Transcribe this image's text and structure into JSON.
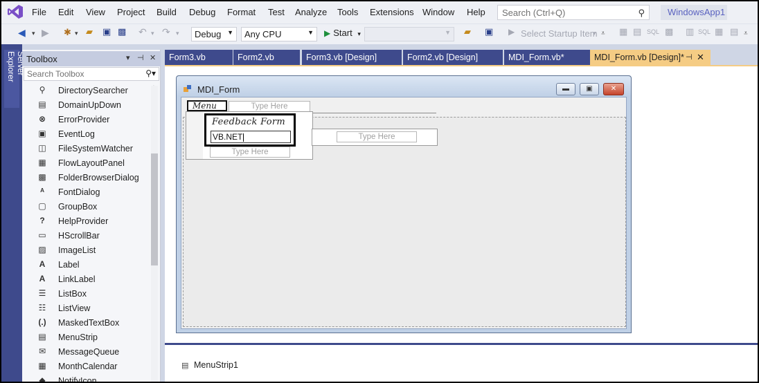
{
  "menubar": {
    "items": [
      "File",
      "Edit",
      "View",
      "Project",
      "Build",
      "Debug",
      "Format",
      "Test",
      "Analyze",
      "Tools",
      "Extensions",
      "Window",
      "Help"
    ],
    "search_placeholder": "Search (Ctrl+Q)",
    "solution_name": "WindowsApp1"
  },
  "toolbar": {
    "configuration": "Debug",
    "platform": "Any CPU",
    "start_label": "Start",
    "startup_item_label": "Select Startup Item"
  },
  "server_explorer": {
    "label": "Server Explorer"
  },
  "toolbox": {
    "title": "Toolbox",
    "search_placeholder": "Search Toolbox",
    "items": [
      {
        "label": "DirectorySearcher",
        "icon": "magnifier-icon",
        "glyph": "⚲"
      },
      {
        "label": "DomainUpDown",
        "icon": "updown-icon",
        "glyph": "▤"
      },
      {
        "label": "ErrorProvider",
        "icon": "error-icon",
        "glyph": "⊗"
      },
      {
        "label": "EventLog",
        "icon": "eventlog-icon",
        "glyph": "▣"
      },
      {
        "label": "FileSystemWatcher",
        "icon": "watcher-icon",
        "glyph": "◫"
      },
      {
        "label": "FlowLayoutPanel",
        "icon": "flowlayout-icon",
        "glyph": "▦"
      },
      {
        "label": "FolderBrowserDialog",
        "icon": "folder-dialog-icon",
        "glyph": "▩"
      },
      {
        "label": "FontDialog",
        "icon": "font-dialog-icon",
        "glyph": "ᴬ"
      },
      {
        "label": "GroupBox",
        "icon": "groupbox-icon",
        "glyph": "▢"
      },
      {
        "label": "HelpProvider",
        "icon": "help-icon",
        "glyph": "?"
      },
      {
        "label": "HScrollBar",
        "icon": "hscrollbar-icon",
        "glyph": "▭"
      },
      {
        "label": "ImageList",
        "icon": "imagelist-icon",
        "glyph": "▨"
      },
      {
        "label": "Label",
        "icon": "label-icon",
        "glyph": "A"
      },
      {
        "label": "LinkLabel",
        "icon": "linklabel-icon",
        "glyph": "A"
      },
      {
        "label": "ListBox",
        "icon": "listbox-icon",
        "glyph": "☰"
      },
      {
        "label": "ListView",
        "icon": "listview-icon",
        "glyph": "☷"
      },
      {
        "label": "MaskedTextBox",
        "icon": "maskedtextbox-icon",
        "glyph": "(.)"
      },
      {
        "label": "MenuStrip",
        "icon": "menustrip-icon",
        "glyph": "▤"
      },
      {
        "label": "MessageQueue",
        "icon": "messagequeue-icon",
        "glyph": "✉"
      },
      {
        "label": "MonthCalendar",
        "icon": "calendar-icon",
        "glyph": "▦"
      },
      {
        "label": "NotifyIcon",
        "icon": "notifyicon-icon",
        "glyph": "◆"
      }
    ]
  },
  "tabs": [
    {
      "label": "Form3.vb"
    },
    {
      "label": "Form2.vb"
    },
    {
      "label": "Form3.vb [Design]"
    },
    {
      "label": "Form2.vb [Design]"
    },
    {
      "label": "MDI_Form.vb*"
    },
    {
      "label": "MDI_Form.vb [Design]*"
    }
  ],
  "form": {
    "title": "MDI_Form",
    "menu_top_item": "Menu",
    "type_here": "Type Here",
    "dropdown_item": "Feedback Form",
    "edit_value": "VB.NET"
  },
  "tray": {
    "component": "MenuStrip1"
  },
  "colors": {
    "accent": "#3e4a8c",
    "active_tab": "#f5cc84",
    "logo": "#7a4fc7"
  }
}
